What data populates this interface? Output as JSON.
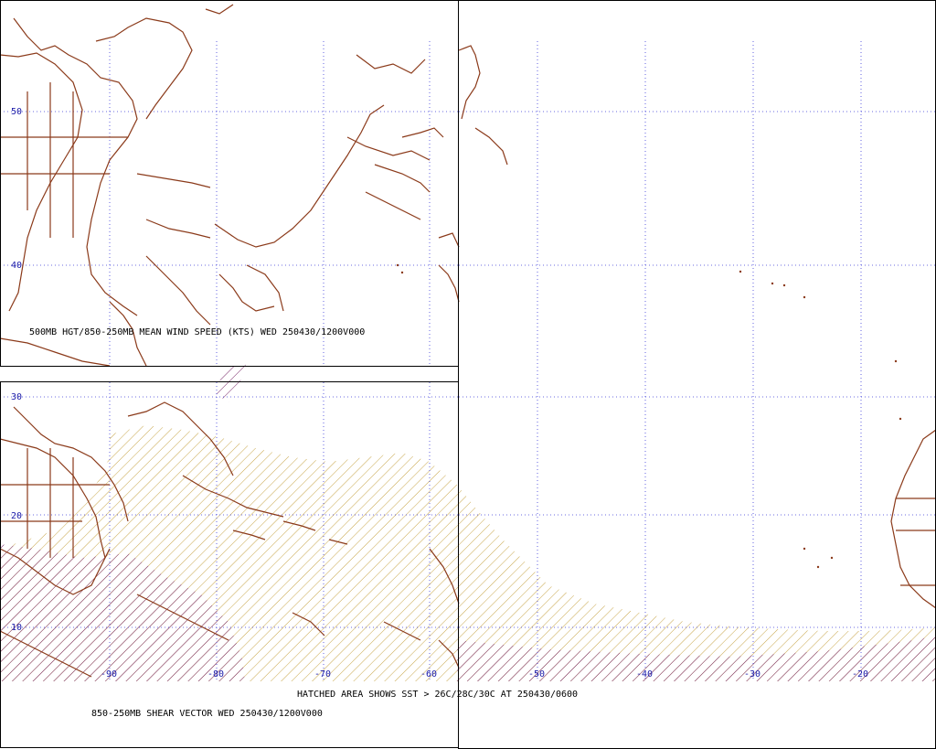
{
  "colors": {
    "grid": "#3b3bd9",
    "coast": "#8b3a1a",
    "hatch_sst": "#c8a64a",
    "hatch_shear": "#7a2a6a",
    "frame": "#000000",
    "label": "#1a1aa8",
    "caption": "#000000"
  },
  "upper_panel": {
    "caption": "500MB HGT/850-250MB MEAN WIND SPEED (KTS) WED 250430/1200V000",
    "lat_labels": [
      "50",
      "40"
    ]
  },
  "lower_panel": {
    "caption": "850-250MB SHEAR VECTOR WED 250430/1200V000",
    "lat_labels": [
      "30",
      "20",
      "10"
    ],
    "lon_labels": [
      "-90",
      "-80",
      "-70",
      "-60"
    ]
  },
  "main_map": {
    "caption": "HATCHED AREA SHOWS SST > 26C/28C/30C AT 250430/0600",
    "lon_labels": [
      "-50",
      "-40",
      "-30",
      "-20"
    ]
  }
}
